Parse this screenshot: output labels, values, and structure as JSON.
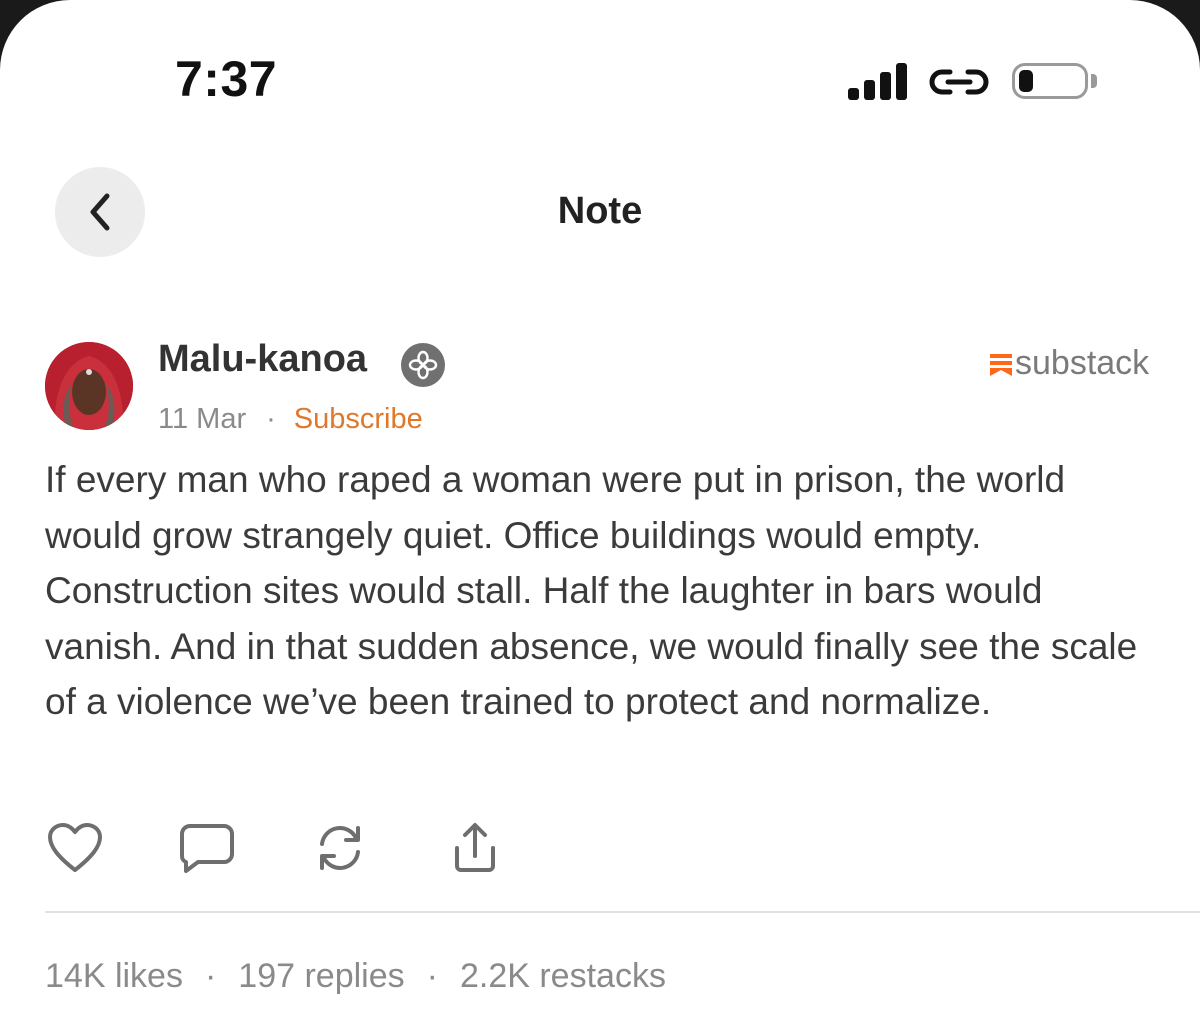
{
  "status_bar": {
    "time": "7:37",
    "icons": [
      "signal-icon",
      "link-icon",
      "battery-icon"
    ]
  },
  "header": {
    "title": "Note",
    "back_icon": "chevron-left-icon"
  },
  "note": {
    "author": "Malu-kanoa",
    "badge_icon": "flower-badge-icon",
    "date": "11 Mar",
    "separator": "·",
    "subscribe_label": "Subscribe",
    "brand": "substack",
    "body": "If every man who raped a woman were put in prison, the world would grow strangely quiet. Office buildings would empty. Construction sites would stall. Half the laughter in bars would vanish. And in that sudden absence, we would finally see the scale of a violence we’ve been trained to protect and normalize.",
    "actions": [
      "heart-icon",
      "comment-icon",
      "restack-icon",
      "share-icon"
    ]
  },
  "stats": {
    "likes": "14K likes",
    "replies": "197 replies",
    "restacks": "2.2K restacks",
    "separator": "·"
  },
  "colors": {
    "accent": "#e0782b",
    "text": "#3b3b3b",
    "muted": "#8a8a8a"
  }
}
